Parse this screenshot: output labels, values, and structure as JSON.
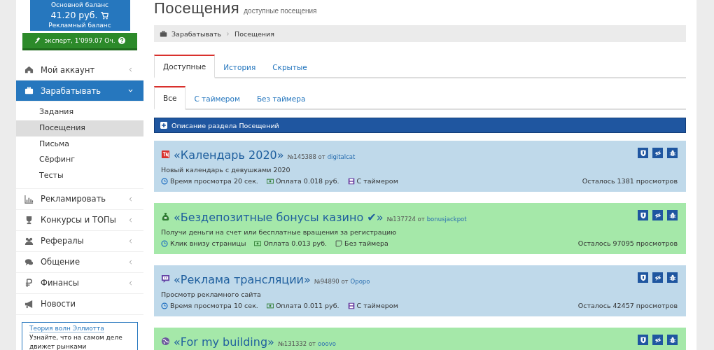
{
  "balance": {
    "main_label": "Основной баланс",
    "main_amount": "41.20 руб.",
    "ad_label": "Рекламный баланс",
    "rank": "эксперт, 1'099.07 Оч."
  },
  "sidebar": {
    "items": [
      {
        "kind": "group",
        "label": "Мой аккаунт",
        "expanded": false,
        "selected": false
      },
      {
        "kind": "group",
        "label": "Зарабатывать",
        "expanded": true,
        "selected": true,
        "children": [
          {
            "label": "Задания",
            "selected": false
          },
          {
            "label": "Посещения",
            "selected": true
          },
          {
            "label": "Письма",
            "selected": false
          },
          {
            "label": "Сёрфинг",
            "selected": false
          },
          {
            "label": "Тесты",
            "selected": false
          }
        ]
      },
      {
        "kind": "group",
        "label": "Рекламировать",
        "expanded": false,
        "selected": false
      },
      {
        "kind": "group",
        "label": "Конкурсы и ТОПы",
        "expanded": false,
        "selected": false
      },
      {
        "kind": "group",
        "label": "Рефералы",
        "expanded": false,
        "selected": false
      },
      {
        "kind": "group",
        "label": "Общение",
        "expanded": false,
        "selected": false
      },
      {
        "kind": "group",
        "label": "Финансы",
        "expanded": false,
        "selected": false
      },
      {
        "kind": "link",
        "label": "Новости",
        "selected": false
      }
    ],
    "ad": {
      "link": "Теория волн Эллиотта",
      "text": "Узнайте, что на самом деле движет рынками"
    }
  },
  "page": {
    "title": "Посещения",
    "subtitle": "доступные посещения"
  },
  "breadcrumb": [
    "Зарабатывать",
    "Посещения"
  ],
  "tabs": [
    {
      "label": "Доступные",
      "selected": true
    },
    {
      "label": "История",
      "selected": false
    },
    {
      "label": "Скрытые",
      "selected": false
    }
  ],
  "subtabs": [
    {
      "label": "Все",
      "selected": true
    },
    {
      "label": "С таймером",
      "selected": false
    },
    {
      "label": "Без таймера",
      "selected": false
    }
  ],
  "info_bar": "Описание раздела Посещений",
  "visits": [
    {
      "color": "#bfd9ea",
      "title": "«Календарь 2020»",
      "number": "№145388 от",
      "author": "digitalcat",
      "description": "Новый календарь с девушками 2020",
      "meta": [
        {
          "kind": "time",
          "text": "Время просмотра 20 сек."
        },
        {
          "kind": "pay",
          "text": "Оплата 0.018 руб."
        },
        {
          "kind": "timer",
          "text": "С таймером"
        }
      ],
      "remaining": "Осталось 1381 просмотров"
    },
    {
      "color": "#a5e8a9",
      "title": "«Бездепозитные бонусы казино ✔»",
      "number": "№137724 от",
      "author": "bonusjackpot",
      "description": "Получи деньги на счет или бесплатные вращения за регистрацию",
      "meta": [
        {
          "kind": "time",
          "text": "Клик внизу страницы"
        },
        {
          "kind": "pay",
          "text": "Оплата 0.013 руб."
        },
        {
          "kind": "notimer",
          "text": "Без таймера"
        }
      ],
      "remaining": "Осталось 97095 просмотров"
    },
    {
      "color": "#bfd9ea",
      "title": "«Реклама трансляции»",
      "number": "№94890 от",
      "author": "Opopo",
      "description": "Просмотр рекламного сайта",
      "meta": [
        {
          "kind": "time",
          "text": "Время просмотра 10 сек."
        },
        {
          "kind": "pay",
          "text": "Оплата 0.011 руб."
        },
        {
          "kind": "timer",
          "text": "С таймером"
        }
      ],
      "remaining": "Осталось 42457 просмотров"
    },
    {
      "color": "#a5e8a9",
      "title": "«For my building»",
      "number": "№131332 от",
      "author": "ooovo"
    }
  ]
}
